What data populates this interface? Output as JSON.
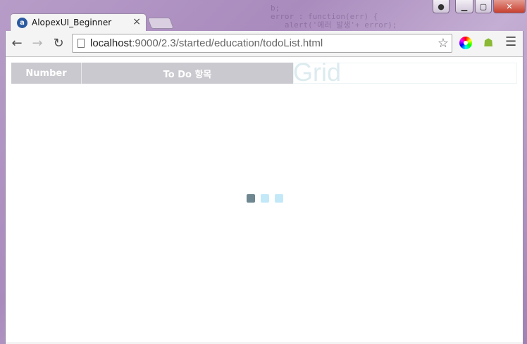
{
  "background": {
    "code_lines": [
      "b;",
      "error : function(err) {",
      "   alert('에러 발생'+ error);"
    ]
  },
  "window": {
    "close_glyph": "✕",
    "min_glyph": "▁",
    "max_glyph": "▢"
  },
  "tab": {
    "title": "AlopexUI_Beginner",
    "close_glyph": "×",
    "favicon_glyph": "a"
  },
  "toolbar": {
    "back_glyph": "←",
    "forward_glyph": "→",
    "reload_glyph": "↻",
    "menu_glyph": "☰",
    "star_glyph": "☆",
    "android_glyph": "☗"
  },
  "omnibox": {
    "host": "localhost",
    "path": ":9000/2.3/started/education/todoList.html"
  },
  "grid": {
    "columns": [
      {
        "label": "Number"
      },
      {
        "label": "To Do 항목"
      }
    ],
    "watermark": "Grid"
  },
  "loader": {
    "colors": [
      "#6e8791",
      "#c3e9f8",
      "#c3e9f8"
    ]
  }
}
